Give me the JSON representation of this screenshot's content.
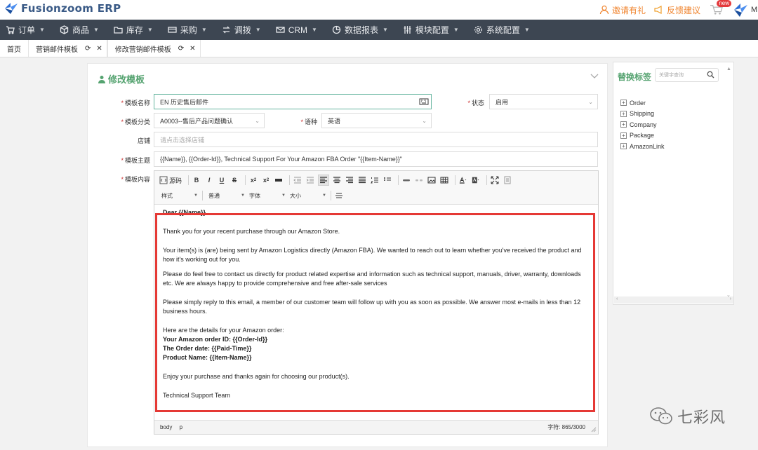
{
  "app": {
    "name": "Fusionzoom ERP"
  },
  "header": {
    "invite_label": "邀请有礼",
    "feedback_label": "反馈建议",
    "new_badge": "new",
    "user_initial": "M"
  },
  "nav": [
    {
      "label": "订单",
      "icon": "cart-icon"
    },
    {
      "label": "商品",
      "icon": "cube-icon"
    },
    {
      "label": "库存",
      "icon": "folder-icon"
    },
    {
      "label": "采购",
      "icon": "card-icon"
    },
    {
      "label": "调拨",
      "icon": "transfer-icon"
    },
    {
      "label": "CRM",
      "icon": "mail-icon"
    },
    {
      "label": "数据报表",
      "icon": "pie-icon"
    },
    {
      "label": "模块配置",
      "icon": "sliders-icon"
    },
    {
      "label": "系统配置",
      "icon": "gear-icon"
    }
  ],
  "tabs": [
    {
      "label": "首页"
    },
    {
      "label": "营销邮件模板"
    },
    {
      "label": "修改营销邮件模板"
    }
  ],
  "form": {
    "panel_title": "修改模板",
    "name_label": "模板名称",
    "name_value": "EN 历史售后邮件",
    "status_label": "状态",
    "status_value": "启用",
    "category_label": "模板分类",
    "category_value": "A0003--售后产品问题确认",
    "language_label": "语种",
    "language_value": "英语",
    "shop_label": "店铺",
    "shop_placeholder": "请点击选择店铺",
    "subject_label": "模板主题",
    "subject_value": "{{Name}}, {{Order-Id}}, Technical Support For Your Amazon FBA Order \"{{Item-Name}}\"",
    "content_label": "模板内容"
  },
  "toolbar": {
    "source_label": "源码",
    "style_combo": "样式",
    "format_combo": "普通",
    "font_combo": "字体",
    "size_combo": "大小"
  },
  "email": {
    "greeting": "Dear {{Name}}",
    "p1": "Thank you for your recent purchase through our Amazon Store.",
    "p2": "Your item(s) is (are) being sent by Amazon Logistics directly (Amazon FBA). We wanted to reach out to learn whether you've received the product and how it's working out for you.",
    "p3": "Please do feel free to contact us directly for product related expertise and information such as technical support, manuals, driver, warranty, downloads etc. We are always happy to provide comprehensive and free after-sale services",
    "p4": "Please simply reply to this email, a member of our customer team will follow up with you as soon as possible. We answer most e-mails in less than 12 business hours.",
    "details_intro": "Here are the details for your Amazon order:",
    "order_id": "Your Amazon order ID: {{Order-Id}}",
    "order_date": "The Order date: {{Paid-Time}}",
    "product_name": "Product Name: {{Item-Name}}",
    "p5": "Enjoy your purchase and thanks again for choosing our product(s).",
    "signature": "Technical Support Team"
  },
  "statusbar": {
    "path": "body p",
    "char_count": "字符: 865/3000"
  },
  "sidebar": {
    "title": "替换标签",
    "search_placeholder": "关键字查询",
    "items": [
      {
        "label": "Order"
      },
      {
        "label": "Shipping"
      },
      {
        "label": "Company"
      },
      {
        "label": "Package"
      },
      {
        "label": "AmazonLink"
      }
    ]
  },
  "watermark": {
    "text": "七彩风"
  },
  "colors": {
    "accent_green": "#55a370",
    "nav_bg": "#3d4652",
    "highlight_red": "#e53935",
    "link_orange": "#f0842e"
  }
}
